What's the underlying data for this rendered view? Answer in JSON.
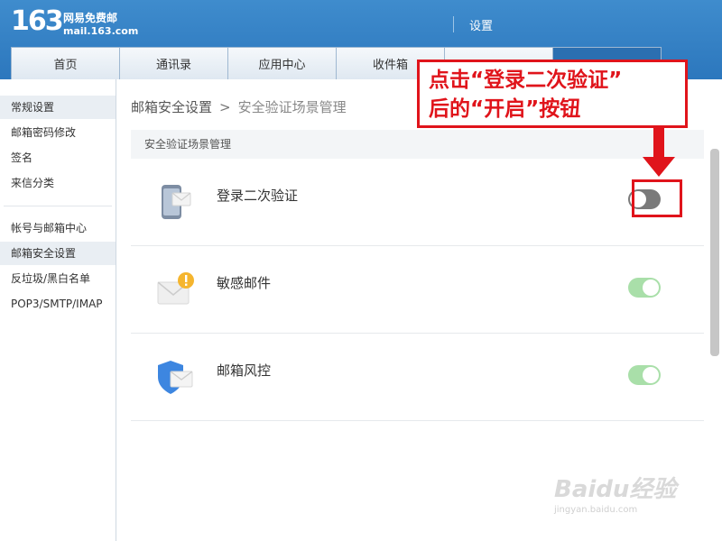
{
  "header": {
    "logo_number": "163",
    "logo_cn": "网易免费邮",
    "logo_en": "mail.163.com",
    "title": "设置"
  },
  "tabs": [
    {
      "label": "首页"
    },
    {
      "label": "通讯录"
    },
    {
      "label": "应用中心"
    },
    {
      "label": "收件箱"
    },
    {
      "label": ""
    },
    {
      "label": ""
    }
  ],
  "sidebar": {
    "items": [
      {
        "label": "常规设置"
      },
      {
        "label": "邮箱密码修改"
      },
      {
        "label": "签名"
      },
      {
        "label": "来信分类"
      },
      {
        "label": "帐号与邮箱中心"
      },
      {
        "label": "邮箱安全设置"
      },
      {
        "label": "反垃圾/黑白名单"
      },
      {
        "label": "POP3/SMTP/IMAP"
      }
    ]
  },
  "breadcrumb": {
    "parent": "邮箱安全设置",
    "separator": ">",
    "current": "安全验证场景管理"
  },
  "section": {
    "title": "安全验证场景管理"
  },
  "settings": [
    {
      "label": "登录二次验证",
      "enabled": false,
      "icon": "phone-mail-icon"
    },
    {
      "label": "敏感邮件",
      "enabled": true,
      "icon": "mail-alert-icon"
    },
    {
      "label": "邮箱风控",
      "enabled": true,
      "icon": "shield-mail-icon"
    }
  ],
  "annotation": {
    "line1": "点击“登录二次验证”",
    "line2": "后的“开启”按钮",
    "color": "#e0141b"
  },
  "watermark": {
    "text": "Baidu经验",
    "sub": "jingyan.baidu.com"
  },
  "colors": {
    "header_blue": "#2c77bd",
    "active_tab": "#2b6fb1",
    "toggle_on": "#a9dfa9",
    "toggle_off": "#7a7a7a"
  }
}
